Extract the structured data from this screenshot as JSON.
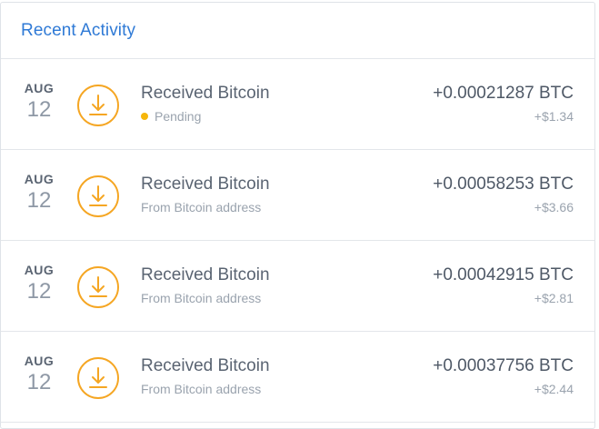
{
  "header": {
    "title": "Recent Activity"
  },
  "colors": {
    "accent": "#2f7ad6",
    "icon": "#f5a623",
    "pending": "#f6b60b"
  },
  "transactions": [
    {
      "month": "AUG",
      "day": "12",
      "icon": "download-icon",
      "title": "Received Bitcoin",
      "subtitle": "Pending",
      "pending": true,
      "amount_btc": "+0.00021287 BTC",
      "amount_usd": "+$1.34"
    },
    {
      "month": "AUG",
      "day": "12",
      "icon": "download-icon",
      "title": "Received Bitcoin",
      "subtitle": "From Bitcoin address",
      "pending": false,
      "amount_btc": "+0.00058253 BTC",
      "amount_usd": "+$3.66"
    },
    {
      "month": "AUG",
      "day": "12",
      "icon": "download-icon",
      "title": "Received Bitcoin",
      "subtitle": "From Bitcoin address",
      "pending": false,
      "amount_btc": "+0.00042915 BTC",
      "amount_usd": "+$2.81"
    },
    {
      "month": "AUG",
      "day": "12",
      "icon": "download-icon",
      "title": "Received Bitcoin",
      "subtitle": "From Bitcoin address",
      "pending": false,
      "amount_btc": "+0.00037756 BTC",
      "amount_usd": "+$2.44"
    }
  ]
}
